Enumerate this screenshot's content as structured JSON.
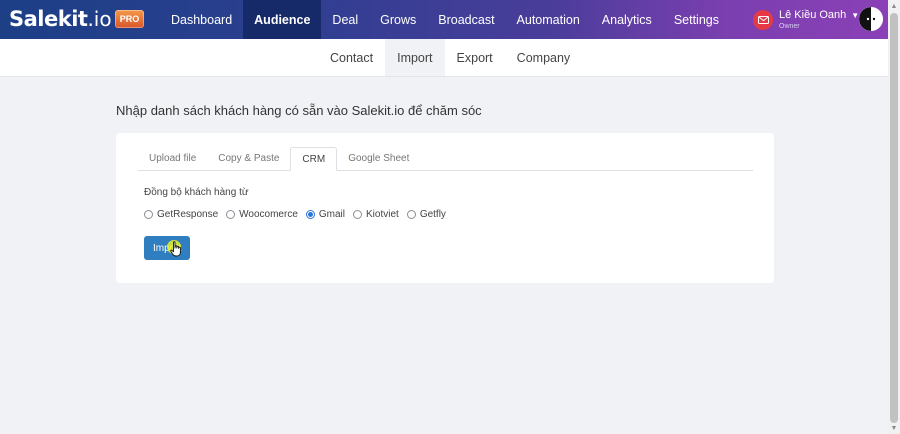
{
  "brand": {
    "logo_main": "Salekit",
    "logo_suffix": ".io",
    "plan_badge": "PRO"
  },
  "nav": {
    "items": [
      {
        "label": "Dashboard"
      },
      {
        "label": "Audience",
        "active": true
      },
      {
        "label": "Deal"
      },
      {
        "label": "Grows"
      },
      {
        "label": "Broadcast"
      },
      {
        "label": "Automation"
      },
      {
        "label": "Analytics"
      },
      {
        "label": "Settings"
      }
    ]
  },
  "user": {
    "name": "Lê Kiều Oanh",
    "role": "Owner",
    "icon": "mail-icon"
  },
  "subnav": {
    "items": [
      {
        "label": "Contact"
      },
      {
        "label": "Import",
        "active": true
      },
      {
        "label": "Export"
      },
      {
        "label": "Company"
      }
    ]
  },
  "page": {
    "title": "Nhập danh sách khách hàng có sẵn vào Salekit.io để chăm sóc"
  },
  "import_card": {
    "tabs": [
      {
        "label": "Upload file"
      },
      {
        "label": "Copy & Paste"
      },
      {
        "label": "CRM",
        "active": true
      },
      {
        "label": "Google Sheet"
      }
    ],
    "sync_label": "Đồng bộ khách hàng từ",
    "sources": [
      {
        "label": "GetResponse",
        "checked": false
      },
      {
        "label": "Woocomerce",
        "checked": false
      },
      {
        "label": "Gmail",
        "checked": true
      },
      {
        "label": "Kiotviet",
        "checked": false
      },
      {
        "label": "Getfly",
        "checked": false
      }
    ],
    "selected_source": "Gmail",
    "import_button": "Import"
  },
  "colors": {
    "nav_gradient_start": "#1c3f86",
    "nav_gradient_end": "#8a40b6",
    "nav_active": "#162a6a",
    "button": "#2f7fc0",
    "radio_checked": "#2b74d8",
    "mail_icon": "#e53945"
  }
}
